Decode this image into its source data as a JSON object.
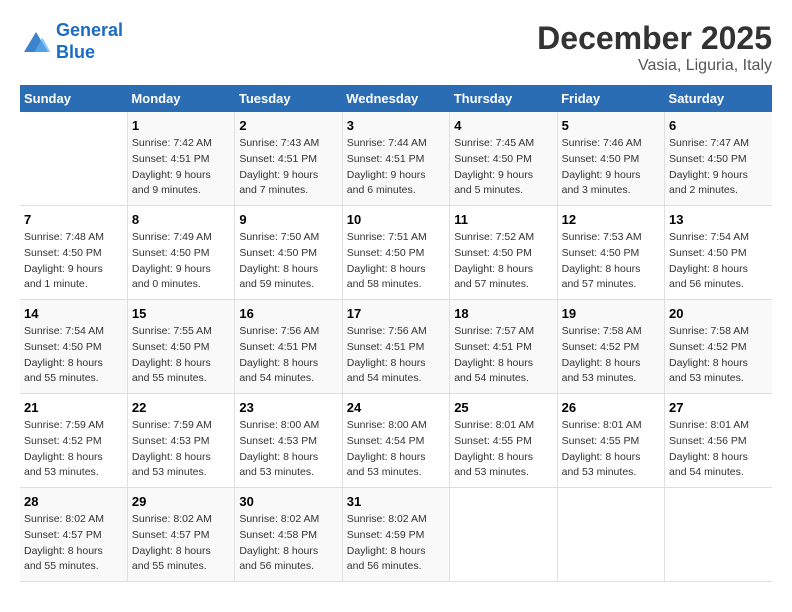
{
  "header": {
    "logo_line1": "General",
    "logo_line2": "Blue",
    "month": "December 2025",
    "location": "Vasia, Liguria, Italy"
  },
  "weekdays": [
    "Sunday",
    "Monday",
    "Tuesday",
    "Wednesday",
    "Thursday",
    "Friday",
    "Saturday"
  ],
  "weeks": [
    [
      {
        "day": "",
        "info": ""
      },
      {
        "day": "1",
        "info": "Sunrise: 7:42 AM\nSunset: 4:51 PM\nDaylight: 9 hours\nand 9 minutes."
      },
      {
        "day": "2",
        "info": "Sunrise: 7:43 AM\nSunset: 4:51 PM\nDaylight: 9 hours\nand 7 minutes."
      },
      {
        "day": "3",
        "info": "Sunrise: 7:44 AM\nSunset: 4:51 PM\nDaylight: 9 hours\nand 6 minutes."
      },
      {
        "day": "4",
        "info": "Sunrise: 7:45 AM\nSunset: 4:50 PM\nDaylight: 9 hours\nand 5 minutes."
      },
      {
        "day": "5",
        "info": "Sunrise: 7:46 AM\nSunset: 4:50 PM\nDaylight: 9 hours\nand 3 minutes."
      },
      {
        "day": "6",
        "info": "Sunrise: 7:47 AM\nSunset: 4:50 PM\nDaylight: 9 hours\nand 2 minutes."
      }
    ],
    [
      {
        "day": "7",
        "info": "Sunrise: 7:48 AM\nSunset: 4:50 PM\nDaylight: 9 hours\nand 1 minute."
      },
      {
        "day": "8",
        "info": "Sunrise: 7:49 AM\nSunset: 4:50 PM\nDaylight: 9 hours\nand 0 minutes."
      },
      {
        "day": "9",
        "info": "Sunrise: 7:50 AM\nSunset: 4:50 PM\nDaylight: 8 hours\nand 59 minutes."
      },
      {
        "day": "10",
        "info": "Sunrise: 7:51 AM\nSunset: 4:50 PM\nDaylight: 8 hours\nand 58 minutes."
      },
      {
        "day": "11",
        "info": "Sunrise: 7:52 AM\nSunset: 4:50 PM\nDaylight: 8 hours\nand 57 minutes."
      },
      {
        "day": "12",
        "info": "Sunrise: 7:53 AM\nSunset: 4:50 PM\nDaylight: 8 hours\nand 57 minutes."
      },
      {
        "day": "13",
        "info": "Sunrise: 7:54 AM\nSunset: 4:50 PM\nDaylight: 8 hours\nand 56 minutes."
      }
    ],
    [
      {
        "day": "14",
        "info": "Sunrise: 7:54 AM\nSunset: 4:50 PM\nDaylight: 8 hours\nand 55 minutes."
      },
      {
        "day": "15",
        "info": "Sunrise: 7:55 AM\nSunset: 4:50 PM\nDaylight: 8 hours\nand 55 minutes."
      },
      {
        "day": "16",
        "info": "Sunrise: 7:56 AM\nSunset: 4:51 PM\nDaylight: 8 hours\nand 54 minutes."
      },
      {
        "day": "17",
        "info": "Sunrise: 7:56 AM\nSunset: 4:51 PM\nDaylight: 8 hours\nand 54 minutes."
      },
      {
        "day": "18",
        "info": "Sunrise: 7:57 AM\nSunset: 4:51 PM\nDaylight: 8 hours\nand 54 minutes."
      },
      {
        "day": "19",
        "info": "Sunrise: 7:58 AM\nSunset: 4:52 PM\nDaylight: 8 hours\nand 53 minutes."
      },
      {
        "day": "20",
        "info": "Sunrise: 7:58 AM\nSunset: 4:52 PM\nDaylight: 8 hours\nand 53 minutes."
      }
    ],
    [
      {
        "day": "21",
        "info": "Sunrise: 7:59 AM\nSunset: 4:52 PM\nDaylight: 8 hours\nand 53 minutes."
      },
      {
        "day": "22",
        "info": "Sunrise: 7:59 AM\nSunset: 4:53 PM\nDaylight: 8 hours\nand 53 minutes."
      },
      {
        "day": "23",
        "info": "Sunrise: 8:00 AM\nSunset: 4:53 PM\nDaylight: 8 hours\nand 53 minutes."
      },
      {
        "day": "24",
        "info": "Sunrise: 8:00 AM\nSunset: 4:54 PM\nDaylight: 8 hours\nand 53 minutes."
      },
      {
        "day": "25",
        "info": "Sunrise: 8:01 AM\nSunset: 4:55 PM\nDaylight: 8 hours\nand 53 minutes."
      },
      {
        "day": "26",
        "info": "Sunrise: 8:01 AM\nSunset: 4:55 PM\nDaylight: 8 hours\nand 53 minutes."
      },
      {
        "day": "27",
        "info": "Sunrise: 8:01 AM\nSunset: 4:56 PM\nDaylight: 8 hours\nand 54 minutes."
      }
    ],
    [
      {
        "day": "28",
        "info": "Sunrise: 8:02 AM\nSunset: 4:57 PM\nDaylight: 8 hours\nand 55 minutes."
      },
      {
        "day": "29",
        "info": "Sunrise: 8:02 AM\nSunset: 4:57 PM\nDaylight: 8 hours\nand 55 minutes."
      },
      {
        "day": "30",
        "info": "Sunrise: 8:02 AM\nSunset: 4:58 PM\nDaylight: 8 hours\nand 56 minutes."
      },
      {
        "day": "31",
        "info": "Sunrise: 8:02 AM\nSunset: 4:59 PM\nDaylight: 8 hours\nand 56 minutes."
      },
      {
        "day": "",
        "info": ""
      },
      {
        "day": "",
        "info": ""
      },
      {
        "day": "",
        "info": ""
      }
    ]
  ]
}
